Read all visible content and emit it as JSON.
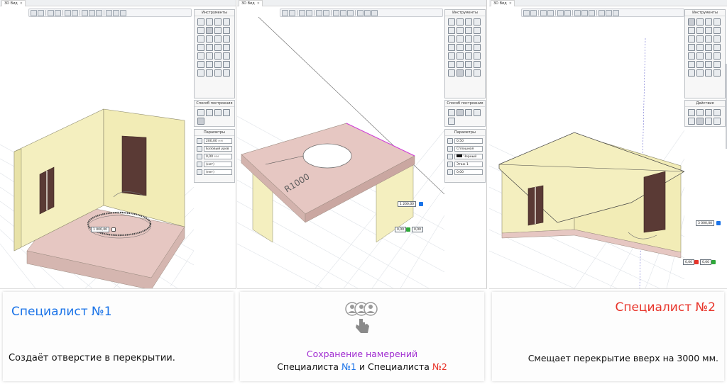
{
  "colors": {
    "specialist1": "#1a73e8",
    "specialist2": "#e8342a",
    "intent": "#a12ed1",
    "wall": "#f4efbf",
    "slab": "#e6c7c2",
    "door": "#5a3a35"
  },
  "panels": [
    {
      "tab_label": "3D Вид",
      "tab_close": "×",
      "palette_title": "Инструменты",
      "method_title": "Способ построения",
      "params_title": "Параметры",
      "params": [
        "200,00",
        "Базовый уров",
        "0,00",
        "(нет)",
        "(нет)"
      ],
      "param_unit": "мм",
      "dimension_input": "1 000,00"
    },
    {
      "tab_label": "3D Вид",
      "tab_close": "×",
      "palette_title": "Инструменты",
      "method_title": "Способ построения",
      "params_title": "Параметры",
      "params": [
        "0,50",
        "Сплошная",
        "Черный",
        "Этаж 1",
        "0,00"
      ],
      "radius_label": "R1000",
      "dimension_input_1": "1 200,00",
      "dimension_input_2": "0,00",
      "dimension_input_3": "0,00"
    },
    {
      "tab_label": "3D Вид",
      "tab_close": "×",
      "palette_title": "Инструменты",
      "actions_title": "Действия",
      "dimension_input_1": "3 000,00",
      "dimension_input_2": "0,00",
      "dimension_input_3": "0,00"
    }
  ],
  "captions": {
    "specialist1_title": "Специалист №1",
    "specialist1_text": "Создаёт отверстие в перекрытии.",
    "intent_title": "Сохранение намерений",
    "intent_line_prefix": "Специалиста ",
    "intent_num1": "№1",
    "intent_and": " и Специалиста ",
    "intent_num2": "№2",
    "specialist2_title": "Специалист №2",
    "specialist2_text": "Смещает перекрытие вверх на 3000 мм."
  }
}
